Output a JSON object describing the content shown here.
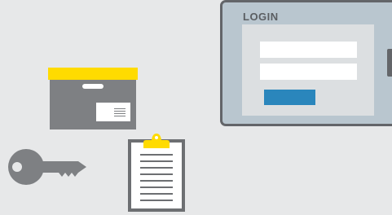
{
  "login": {
    "title": "LOGIN",
    "username_value": "",
    "password_value": ""
  },
  "colors": {
    "background": "#e7e8e9",
    "device_frame": "#636569",
    "device_screen": "#b9c6cf",
    "login_panel": "#dcdfe1",
    "login_button": "#2a86bc",
    "box_lid": "#ffdb00",
    "box_body": "#7e8083",
    "key": "#7e8083",
    "clipboard_frame": "#6d6f72",
    "clipboard_clip": "#ffdb00"
  },
  "icons": {
    "box": "archive-box-icon",
    "key": "key-icon",
    "clipboard": "clipboard-icon"
  }
}
